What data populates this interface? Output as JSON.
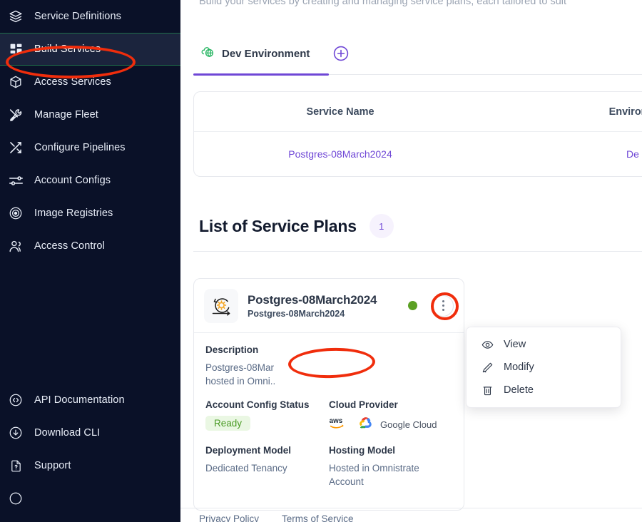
{
  "sidebar": {
    "items": [
      {
        "label": "Service Definitions",
        "icon": "layers-icon",
        "active": false
      },
      {
        "label": "Build Services",
        "icon": "grid-dashboard-icon",
        "active": true
      },
      {
        "label": "Access Services",
        "icon": "cube-icon",
        "active": false
      },
      {
        "label": "Manage Fleet",
        "icon": "tools-icon",
        "active": false
      },
      {
        "label": "Configure Pipelines",
        "icon": "shuffle-icon",
        "active": false
      },
      {
        "label": "Account Configs",
        "icon": "sliders-icon",
        "active": false
      },
      {
        "label": "Image Registries",
        "icon": "disc-icon",
        "active": false
      },
      {
        "label": "Access Control",
        "icon": "users-icon",
        "active": false
      }
    ],
    "bottom_items": [
      {
        "label": "API Documentation",
        "icon": "code-circle-icon"
      },
      {
        "label": "Download CLI",
        "icon": "download-circle-icon"
      },
      {
        "label": "Support",
        "icon": "file-question-icon"
      }
    ]
  },
  "page": {
    "subtitle": "Build your services by creating and managing service plans, each tailored to suit"
  },
  "tabs": {
    "items": [
      {
        "label": "Dev Environment",
        "icon": "cloud-globe-icon",
        "active": true
      }
    ],
    "add_button_icon": "plus-circle-icon"
  },
  "services_table": {
    "columns": [
      "Service Name",
      "Environm"
    ],
    "rows": [
      {
        "service_name": "Postgres-08March2024",
        "environment": "De"
      }
    ]
  },
  "service_plans": {
    "heading": "List of Service Plans",
    "count": "1",
    "card": {
      "logo_icon": "devops-cycle-gear-icon",
      "title": "Postgres-08March2024",
      "subtitle": "Postgres-08March2024",
      "status_icon": "green-status-dot",
      "menu_icon": "kebab-menu-icon",
      "fields": [
        {
          "label": "Description",
          "value": "Postgres-08Mar\nhosted in Omni.."
        },
        {
          "label": "Account Config Status",
          "value": "Ready"
        },
        {
          "label": "Cloud Provider",
          "value": "aws  Google Cloud"
        },
        {
          "label": "Deployment Model",
          "value": "Dedicated Tenancy"
        },
        {
          "label": "Hosting Model",
          "value": "Hosted in Omnistrate Account"
        }
      ],
      "description_lines": [
        "Postgres-08Mar",
        "hosted in Omni.."
      ],
      "account_config_status_label": "Account Config Status",
      "account_config_status_value": "Ready",
      "cloud_provider_label": "Cloud Provider",
      "cloud_provider_aws": "aws",
      "cloud_provider_gcp": "Google Cloud",
      "deployment_model_label": "Deployment Model",
      "deployment_model_value": "Dedicated Tenancy",
      "hosting_model_label": "Hosting Model",
      "hosting_model_value": "Hosted in Omnistrate Account",
      "description_label": "Description"
    }
  },
  "context_menu": {
    "items": [
      {
        "label": "View",
        "icon": "eye-icon"
      },
      {
        "label": "Modify",
        "icon": "pencil-icon"
      },
      {
        "label": "Delete",
        "icon": "trash-icon"
      }
    ]
  },
  "footer": {
    "links": [
      "Privacy Policy",
      "Terms of Service"
    ]
  },
  "colors": {
    "sidebar_bg": "#0a1128",
    "accent_purple": "#6f47d6",
    "status_green": "#5ba023",
    "badge_green_text": "#4a9b25",
    "badge_green_bg": "#eaf7e3",
    "annotation_red": "#f02d0c",
    "link_blue": "#5a6b86"
  }
}
